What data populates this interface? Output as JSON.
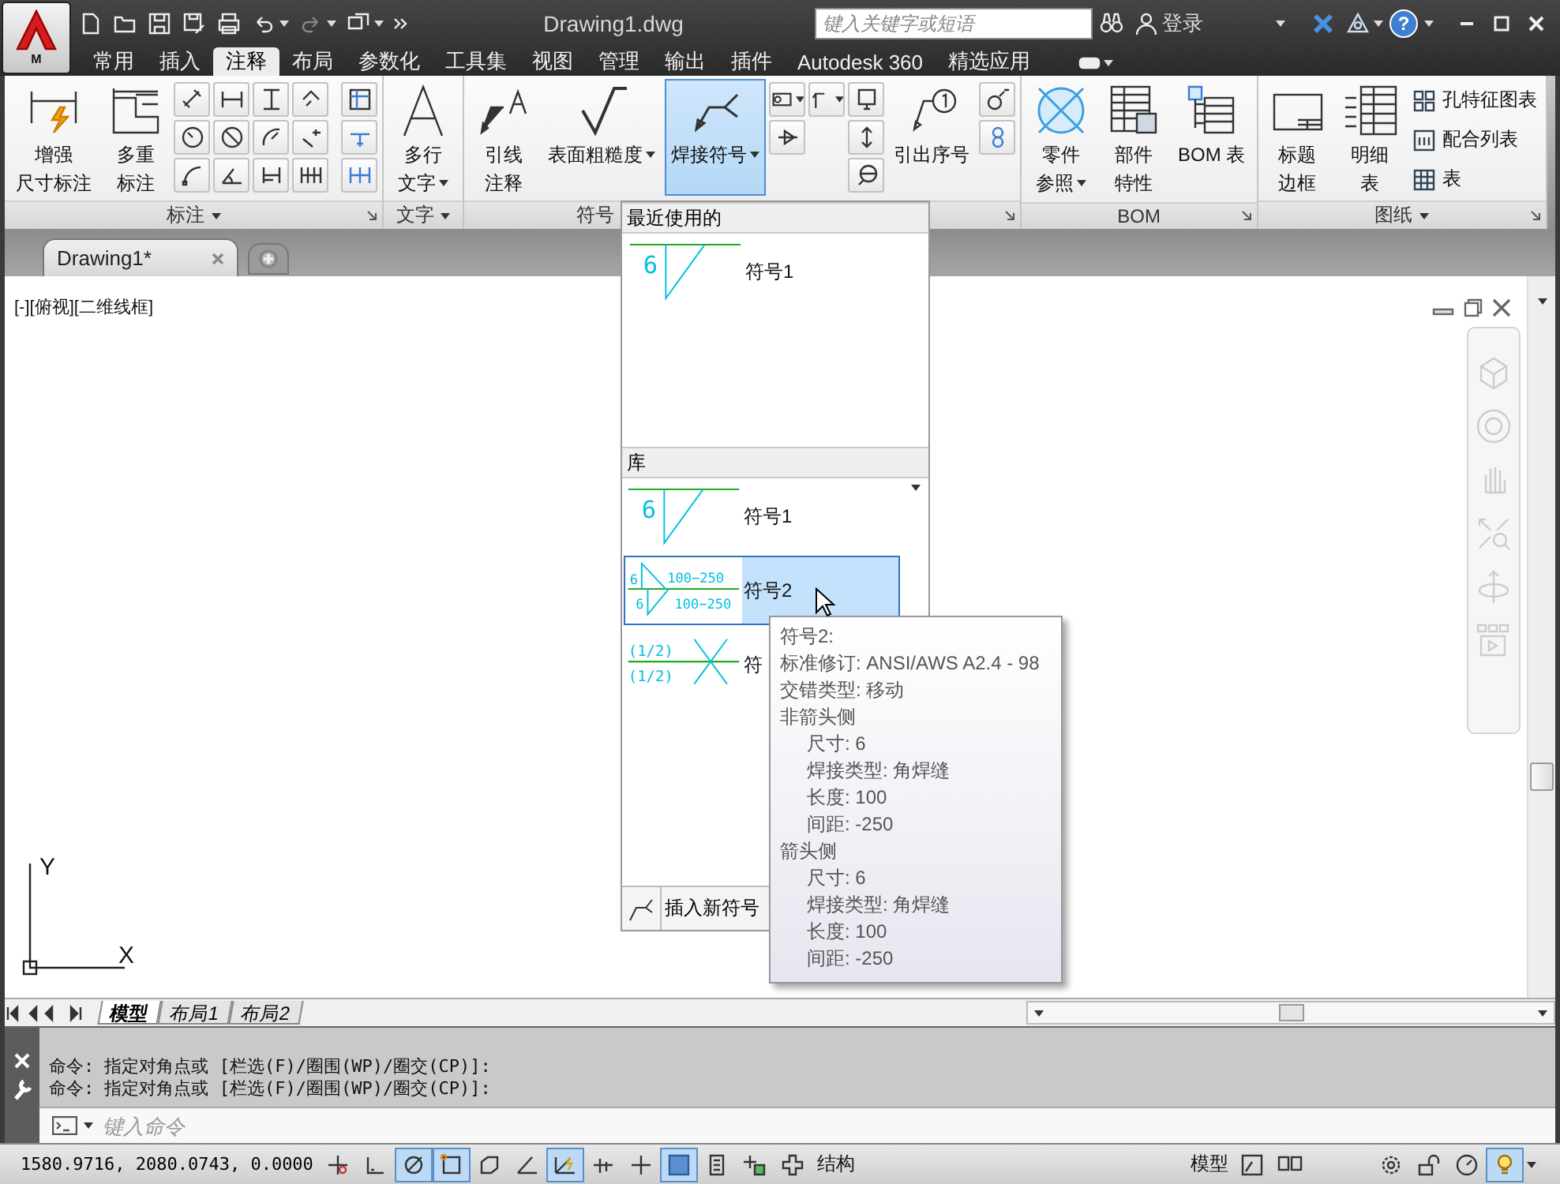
{
  "app_menu": {
    "label": "M"
  },
  "title": "Drawing1.dwg",
  "search": {
    "placeholder": "键入关键字或短语"
  },
  "user": {
    "label": "登录"
  },
  "help": {
    "label": "?"
  },
  "ribbon_tabs": [
    {
      "label": "常用",
      "selected": false
    },
    {
      "label": "插入",
      "selected": false
    },
    {
      "label": "注释",
      "selected": true
    },
    {
      "label": "布局",
      "selected": false
    },
    {
      "label": "参数化",
      "selected": false
    },
    {
      "label": "工具集",
      "selected": false
    },
    {
      "label": "视图",
      "selected": false
    },
    {
      "label": "管理",
      "selected": false
    },
    {
      "label": "输出",
      "selected": false
    },
    {
      "label": "插件",
      "selected": false
    },
    {
      "label": "Autodesk 360",
      "selected": false
    },
    {
      "label": "精选应用",
      "selected": false
    }
  ],
  "panels": [
    {
      "title": "标注",
      "menu": true,
      "launcher": true,
      "buttons": [
        {
          "lines": [
            "增强",
            "尺寸标注"
          ],
          "dropdown": false,
          "selected": false
        },
        {
          "lines": [
            "多重",
            "标注"
          ],
          "dropdown": false,
          "selected": false
        }
      ]
    },
    {
      "title": "文字",
      "menu": true,
      "launcher": false,
      "buttons": [
        {
          "lines": [
            "多行",
            "文字"
          ],
          "dropdown": true,
          "selected": false
        }
      ]
    },
    {
      "title": "符号",
      "menu": false,
      "launcher": true,
      "buttons": [
        {
          "lines": [
            "引线",
            "注释"
          ],
          "dropdown": false,
          "selected": false
        },
        {
          "lines": [
            "表面粗糙度"
          ],
          "dropdown": true,
          "selected": false
        },
        {
          "lines": [
            "焊接符号"
          ],
          "dropdown": true,
          "selected": true
        },
        {
          "lines": [
            "引出序号"
          ],
          "dropdown": false,
          "selected": false
        }
      ]
    },
    {
      "title": "BOM",
      "menu": false,
      "launcher": true,
      "buttons": [
        {
          "lines": [
            "零件",
            "参照"
          ],
          "dropdown": true,
          "selected": false
        },
        {
          "lines": [
            "部件",
            "特性"
          ],
          "dropdown": false,
          "selected": false
        },
        {
          "lines": [
            "BOM 表"
          ],
          "dropdown": false,
          "selected": false
        }
      ]
    },
    {
      "title": "图纸",
      "menu": true,
      "launcher": true,
      "buttons": [
        {
          "lines": [
            "标题",
            "边框"
          ],
          "dropdown": false,
          "selected": false
        },
        {
          "lines": [
            "明细",
            "表"
          ],
          "dropdown": false,
          "selected": false
        }
      ],
      "list_buttons": [
        {
          "label": "孔特征图表"
        },
        {
          "label": "配合列表"
        },
        {
          "label": "表"
        }
      ]
    }
  ],
  "file_tabs": [
    {
      "label": "Drawing1*",
      "selected": true
    }
  ],
  "viewport_label": "[-][俯视][二维线框]",
  "ucs": {
    "x": "X",
    "y": "Y"
  },
  "layout_tabs": [
    {
      "label": "模型",
      "selected": true
    },
    {
      "label": "布局1",
      "selected": false
    },
    {
      "label": "布局2",
      "selected": false
    }
  ],
  "command": {
    "history": [
      "命令: 指定对角点或 [栏选(F)/圈围(WP)/圈交(CP)]:",
      "命令: 指定对角点或 [栏选(F)/圈围(WP)/圈交(CP)]:"
    ],
    "placeholder": "键入命令"
  },
  "status": {
    "coordinates": "1580.9716, 2080.0743, 0.0000",
    "toggles": [
      {
        "on": false
      },
      {
        "on": false
      },
      {
        "on": true
      },
      {
        "on": true
      },
      {
        "on": false
      },
      {
        "on": false
      },
      {
        "on": true
      },
      {
        "on": false
      },
      {
        "on": false
      },
      {
        "on": true
      },
      {
        "on": false
      },
      {
        "on": false
      },
      {
        "on": false
      }
    ],
    "structure_label": "结构",
    "model_label": "模型"
  },
  "weld_menu": {
    "recent_header": "最近使用的",
    "recent": [
      {
        "label": "符号1",
        "selected": false,
        "preview": {
          "kind": "fillet",
          "size": "6"
        }
      }
    ],
    "library_header": "库",
    "library": [
      {
        "label": "符号1",
        "selected": false,
        "preview": {
          "kind": "fillet",
          "size": "6"
        }
      },
      {
        "label": "符号2",
        "selected": true,
        "preview": {
          "kind": "staggered",
          "top_size": "6",
          "top_length": "100−250",
          "bottom_size": "6",
          "bottom_length": "100−250"
        }
      },
      {
        "label": "符",
        "selected": false,
        "preview": {
          "kind": "groove",
          "top": "(1/2)",
          "bottom": "(1/2)"
        }
      }
    ],
    "footer": "插入新符号"
  },
  "tooltip": {
    "title": "符号2:",
    "lines": [
      {
        "text": "标准修订: ANSI/AWS A2.4 - 98"
      },
      {
        "text": "交错类型: 移动"
      },
      {
        "text": "非箭头侧",
        "children": [
          {
            "text": "尺寸: 6"
          },
          {
            "text": "焊接类型: 角焊缝"
          },
          {
            "text": "长度: 100"
          },
          {
            "text": "间距: -250"
          }
        ]
      },
      {
        "text": "箭头侧",
        "children": [
          {
            "text": "尺寸: 6"
          },
          {
            "text": "焊接类型: 角焊缝"
          },
          {
            "text": "长度: 100"
          },
          {
            "text": "间距: -250"
          }
        ]
      }
    ]
  }
}
